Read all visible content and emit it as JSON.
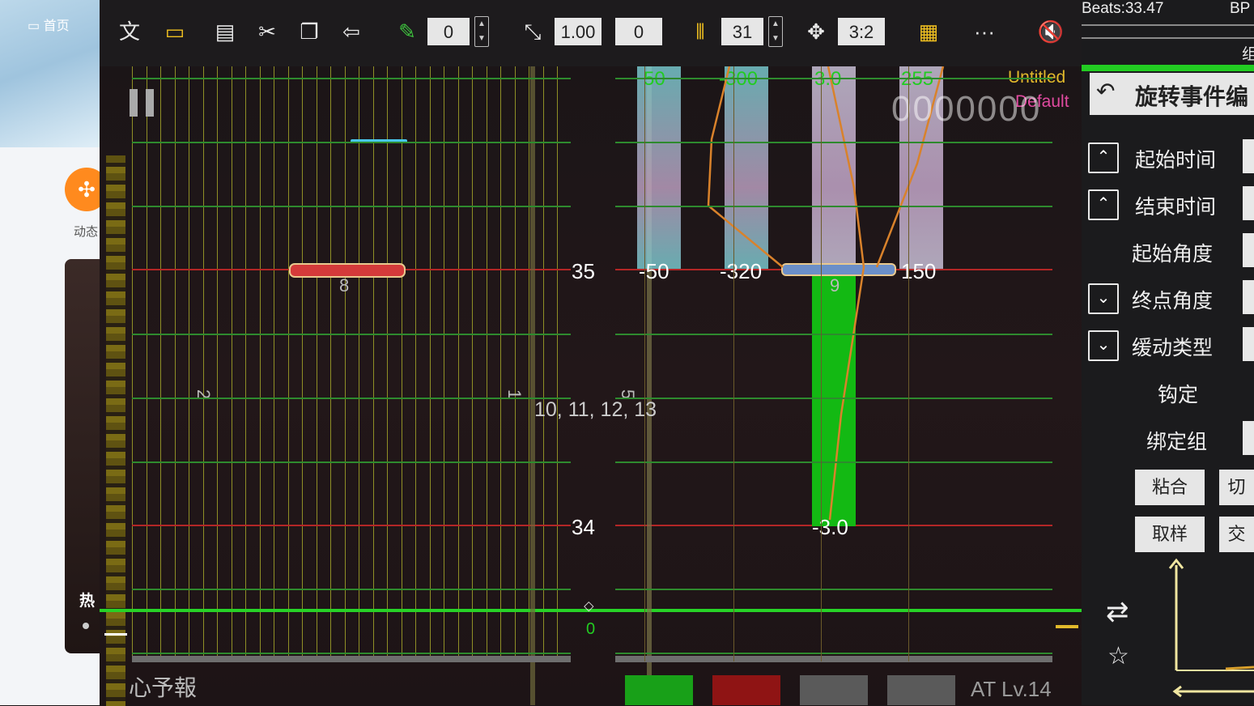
{
  "browser": {
    "home_label": "首页",
    "dynamic_label": "动态",
    "hot_label": "热"
  },
  "toolbar": {
    "value_a": "0",
    "speed": "1.00",
    "value_b": "0",
    "beat_div": "31",
    "ratio": "3:2",
    "more": "···"
  },
  "header": {
    "beats": "Beats:33.47",
    "bpm_partial": "BP",
    "side_char": "组"
  },
  "editor": {
    "chart_name": "Untitled",
    "difficulty": "Default",
    "score": "0000000",
    "song_title": "心予報",
    "level": "AT Lv.14",
    "beat_35": "35",
    "beat_34": "34",
    "zero": "0",
    "group_label": "10, 11, 12, 13",
    "line_nums": [
      "2",
      "1",
      "5"
    ],
    "note_index_8": "8",
    "note_index_9": "9",
    "event_top_values": [
      "50",
      "-300",
      "3.0",
      "255"
    ],
    "event_values": [
      "-50",
      "-320",
      "150"
    ],
    "event_low": "-3.0",
    "colors": {
      "accent_green": "#22cc22",
      "beat_red": "#b32626",
      "event_orange": "#d9822b"
    }
  },
  "panel": {
    "title": "旋转事件编",
    "fields": [
      "起始时间",
      "结束时间",
      "起始角度",
      "终点角度",
      "缓动类型",
      "钩定",
      "绑定组"
    ],
    "btn_snap": "粘合",
    "btn_cut": "切",
    "btn_sample": "取样",
    "btn_swap": "交"
  }
}
